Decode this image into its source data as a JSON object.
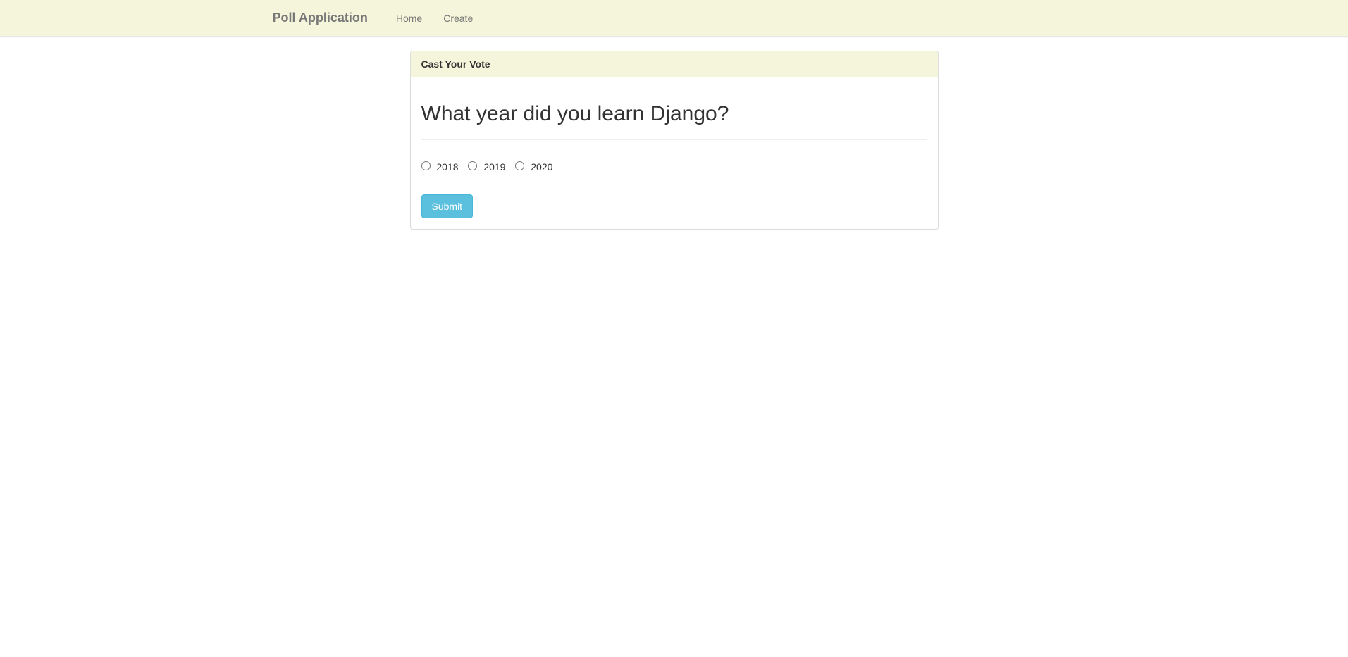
{
  "navbar": {
    "brand": "Poll Application",
    "links": [
      {
        "label": "Home"
      },
      {
        "label": "Create"
      }
    ]
  },
  "panel": {
    "heading": "Cast Your Vote",
    "question": "What year did you learn Django?",
    "options": [
      {
        "label": "2018"
      },
      {
        "label": "2019"
      },
      {
        "label": "2020"
      }
    ],
    "submit_label": "Submit"
  }
}
